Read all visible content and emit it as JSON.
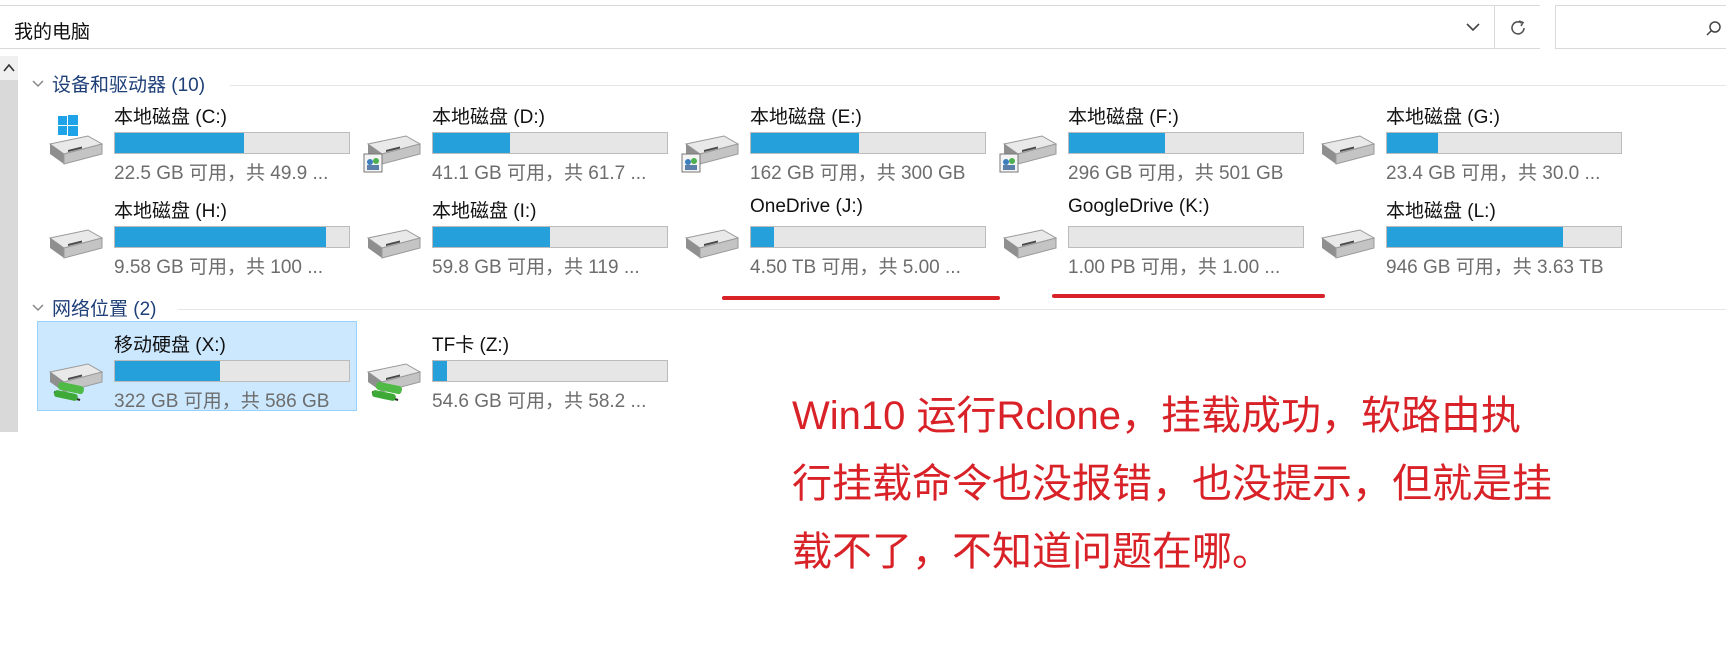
{
  "address": {
    "path": "我的电脑"
  },
  "groups": {
    "devices": {
      "label": "设备和驱动器 (10)"
    },
    "network": {
      "label": "网络位置 (2)"
    }
  },
  "drives": [
    {
      "name": "本地磁盘 (C:)",
      "size": "22.5 GB 可用，共 49.9 ...",
      "used_fraction": 0.55,
      "icon": "windows-drive-icon"
    },
    {
      "name": "本地磁盘 (D:)",
      "size": "41.1 GB 可用，共 61.7 ...",
      "used_fraction": 0.33,
      "icon": "shared-drive-icon"
    },
    {
      "name": "本地磁盘 (E:)",
      "size": "162 GB 可用，共 300 GB",
      "used_fraction": 0.46,
      "icon": "shared-drive-icon"
    },
    {
      "name": "本地磁盘 (F:)",
      "size": "296 GB 可用，共 501 GB",
      "used_fraction": 0.41,
      "icon": "shared-drive-icon"
    },
    {
      "name": "本地磁盘 (G:)",
      "size": "23.4 GB 可用，共 30.0 ...",
      "used_fraction": 0.22,
      "icon": "drive-icon"
    },
    {
      "name": "本地磁盘 (H:)",
      "size": "9.58 GB 可用，共 100 ...",
      "used_fraction": 0.9,
      "icon": "drive-icon"
    },
    {
      "name": "本地磁盘 (I:)",
      "size": "59.8 GB 可用，共 119 ...",
      "used_fraction": 0.5,
      "icon": "drive-icon"
    },
    {
      "name": "OneDrive (J:)",
      "size": "4.50 TB 可用，共 5.00 ...",
      "used_fraction": 0.1,
      "icon": "drive-icon"
    },
    {
      "name": "GoogleDrive (K:)",
      "size": "1.00 PB 可用，共 1.00 ...",
      "used_fraction": 0.0,
      "icon": "drive-icon"
    },
    {
      "name": "本地磁盘 (L:)",
      "size": "946 GB 可用，共 3.63 TB",
      "used_fraction": 0.75,
      "icon": "drive-icon"
    },
    {
      "name": "移动硬盘 (X:)",
      "size": "322 GB 可用，共 586 GB",
      "used_fraction": 0.45,
      "icon": "network-drive-icon",
      "selected": true
    },
    {
      "name": "TF卡 (Z:)",
      "size": "54.6 GB 可用，共 58.2 ...",
      "used_fraction": 0.06,
      "icon": "network-drive-icon"
    }
  ],
  "annotation": {
    "lines": [
      "Win10 运行Rclone，挂载成功，软路由执",
      "行挂载命令也没报错，也没提示，但就是挂",
      "载不了，不知道问题在哪。"
    ],
    "color": "#d92128"
  },
  "colors": {
    "bar_fill": "#26a0da",
    "group_header": "#1e3f78",
    "selection": "#cce8ff"
  }
}
